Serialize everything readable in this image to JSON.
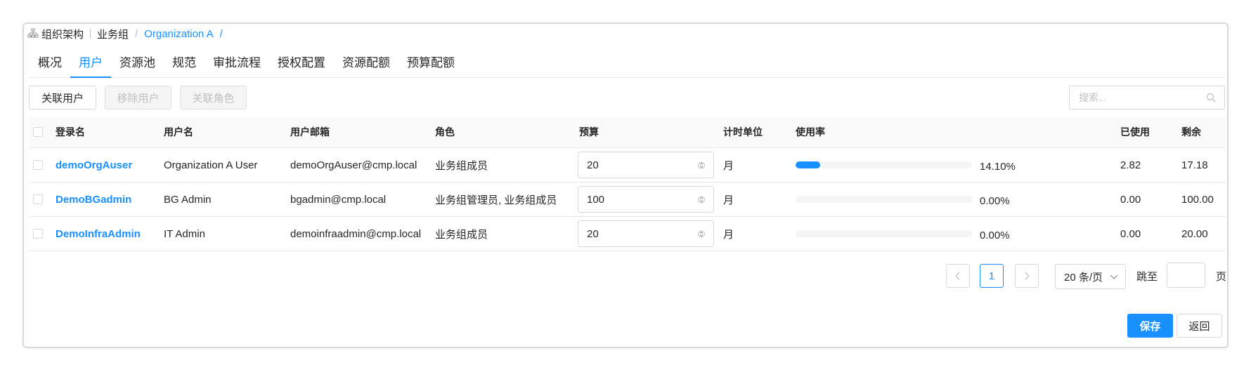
{
  "breadcrumb": {
    "root": "组织架构",
    "group": "业务组",
    "current": "Organization A",
    "tail": "/"
  },
  "tabs": [
    {
      "label": "概况",
      "active": false
    },
    {
      "label": "用户",
      "active": true
    },
    {
      "label": "资源池",
      "active": false
    },
    {
      "label": "规范",
      "active": false
    },
    {
      "label": "审批流程",
      "active": false
    },
    {
      "label": "授权配置",
      "active": false
    },
    {
      "label": "资源配额",
      "active": false
    },
    {
      "label": "预算配额",
      "active": false
    }
  ],
  "toolbar": {
    "link_user": "关联用户",
    "remove_user": "移除用户",
    "link_role": "关联角色",
    "search_placeholder": "搜索..."
  },
  "table": {
    "headers": {
      "login": "登录名",
      "username": "用户名",
      "email": "用户邮箱",
      "role": "角色",
      "budget": "预算",
      "unit": "计时单位",
      "usage": "使用率",
      "used": "已使用",
      "remaining": "剩余"
    },
    "rows": [
      {
        "login": "demoOrgAuser",
        "username": "Organization A User",
        "email": "demoOrgAuser@cmp.local",
        "role": "业务组成员",
        "budget": "20",
        "unit": "月",
        "usage_pct": "14.10%",
        "usage_fraction": 0.141,
        "used": "2.82",
        "remaining": "17.18"
      },
      {
        "login": "DemoBGadmin",
        "username": "BG Admin",
        "email": "bgadmin@cmp.local",
        "role": "业务组管理员, 业务组成员",
        "budget": "100",
        "unit": "月",
        "usage_pct": "0.00%",
        "usage_fraction": 0,
        "used": "0.00",
        "remaining": "100.00"
      },
      {
        "login": "DemoInfraAdmin",
        "username": "IT Admin",
        "email": "demoinfraadmin@cmp.local",
        "role": "业务组成员",
        "budget": "20",
        "unit": "月",
        "usage_pct": "0.00%",
        "usage_fraction": 0,
        "used": "0.00",
        "remaining": "20.00"
      }
    ]
  },
  "pagination": {
    "current_page": "1",
    "page_size": "20 条/页",
    "jump_label": "跳至",
    "page_suffix": "页"
  },
  "footer": {
    "save": "保存",
    "back": "返回"
  },
  "colors": {
    "primary": "#1890ff",
    "border": "#d9d9d9",
    "header_bg": "#fafafa",
    "track": "#f5f5f5"
  }
}
